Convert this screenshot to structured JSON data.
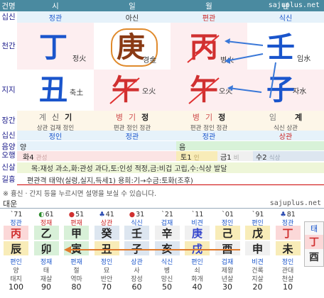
{
  "header": {
    "title": "건명",
    "cols": [
      "시",
      "일",
      "월",
      "년"
    ],
    "site": "sajuplus.net"
  },
  "rows": {
    "sipsin": "십신",
    "cheongan": "천간",
    "jiji": "지지",
    "janggan": "장간",
    "sipsin2": "십신",
    "eumyang": "음양\n오행",
    "sinsal": "신살",
    "gilhyung": "길흉"
  },
  "sipsin_top": [
    "정관",
    "아신",
    "편관",
    "식신"
  ],
  "stems": [
    {
      "char": "丁",
      "elem": "정火",
      "color": "#1a55cc"
    },
    {
      "char": "庚",
      "elem": "경金",
      "color": "#8a3a14"
    },
    {
      "char": "丙",
      "elem": "병火",
      "color": "#d03030"
    },
    {
      "char": "壬",
      "elem": "임水",
      "color": "#1a55cc"
    }
  ],
  "branches": [
    {
      "char": "丑",
      "elem": "축土",
      "color": "#1a55cc"
    },
    {
      "char": "午",
      "elem": "오火",
      "color": "#d03030"
    },
    {
      "char": "午",
      "elem": "오火",
      "color": "#d03030"
    },
    {
      "char": "子",
      "elem": "자水",
      "color": "#1a55cc"
    }
  ],
  "janggan": [
    {
      "chars": [
        "계",
        "신",
        "기"
      ],
      "sub": "상관 겁재 정인"
    },
    {
      "chars": [
        "병",
        "기",
        "정"
      ],
      "sub": "편관 정인 정관"
    },
    {
      "chars": [
        "병",
        "기",
        "정"
      ],
      "sub": "편관 정인 정관"
    },
    {
      "chars": [
        "임",
        "",
        "계"
      ],
      "sub": "식신 상관"
    }
  ],
  "sipsin_bottom": [
    "정인",
    "정관",
    "정관",
    "상관"
  ],
  "eumyang": {
    "yang": "양",
    "eum": "음"
  },
  "ohang": [
    {
      "label": "화4",
      "sub": "관성"
    },
    {
      "label": "토1",
      "sub": "인"
    },
    {
      "label": "금1",
      "sub": "비"
    },
    {
      "label": "수2",
      "sub": "식상"
    }
  ],
  "sinsal": "목:재성 과소,화:관성 과다,토:인성 적정,금:비겁 고립,수:식상 발달",
  "gilhyung": "편관격 태약(실령,실지,득세1)  용희:기→수금:토화(조후)",
  "notice": "※ 흉신 · 간지 등을 누르시면 설명을 보실 수 있습니다.",
  "daeun_title": "대운",
  "site2": "sajuplus.net",
  "daeun": [
    {
      "age_top": "`71",
      "icon": "",
      "sip": "정관",
      "stem": "丙",
      "branch": "辰",
      "sub1": "편인",
      "sub2": "양",
      "sub3": "태지",
      "age": "100"
    },
    {
      "age_top": "61",
      "icon": "◐",
      "sip": "정재",
      "stem": "乙",
      "branch": "卯",
      "sub1": "정재",
      "sub2": "태",
      "sub3": "재살",
      "age": "90"
    },
    {
      "age_top": "51",
      "icon": "●",
      "sip": "편재",
      "stem": "甲",
      "branch": "寅",
      "sub1": "편재",
      "sub2": "절",
      "sub3": "역마",
      "age": "80"
    },
    {
      "age_top": "41",
      "icon": "♣",
      "sip": "상관",
      "stem": "癸",
      "branch": "丑",
      "sub1": "정인",
      "sub2": "묘",
      "sub3": "반안",
      "age": "70"
    },
    {
      "age_top": "31",
      "icon": "●",
      "sip": "식신",
      "stem": "壬",
      "branch": "子",
      "sub1": "상관",
      "sub2": "사",
      "sub3": "장성",
      "age": "60"
    },
    {
      "age_top": "`21",
      "icon": "",
      "sip": "겁재",
      "stem": "辛",
      "branch": "亥",
      "sub1": "식신",
      "sub2": "병",
      "sub3": "망신",
      "age": "50"
    },
    {
      "age_top": "`11",
      "icon": "",
      "sip": "비견",
      "stem": "庚",
      "branch": "戌",
      "sub1": "편인",
      "sub2": "쇠",
      "sub3": "화개",
      "age": "40"
    },
    {
      "age_top": "`01",
      "icon": "",
      "sip": "정인",
      "stem": "己",
      "branch": "酉",
      "sub1": "겁재",
      "sub2": "제왕",
      "sub3": "년살",
      "age": "30"
    },
    {
      "age_top": "`91",
      "icon": "",
      "sip": "편인",
      "stem": "戊",
      "branch": "申",
      "sub1": "비견",
      "sub2": "건록",
      "sub3": "지살",
      "age": "20"
    },
    {
      "age_top": "81",
      "icon": "♣",
      "sip": "정관",
      "stem": "丁",
      "branch": "未",
      "sub1": "정인",
      "sub2": "관대",
      "sub3": "천살",
      "age": "10"
    }
  ],
  "tae": {
    "label": "태",
    "stem": "丁",
    "branch": "酉"
  }
}
